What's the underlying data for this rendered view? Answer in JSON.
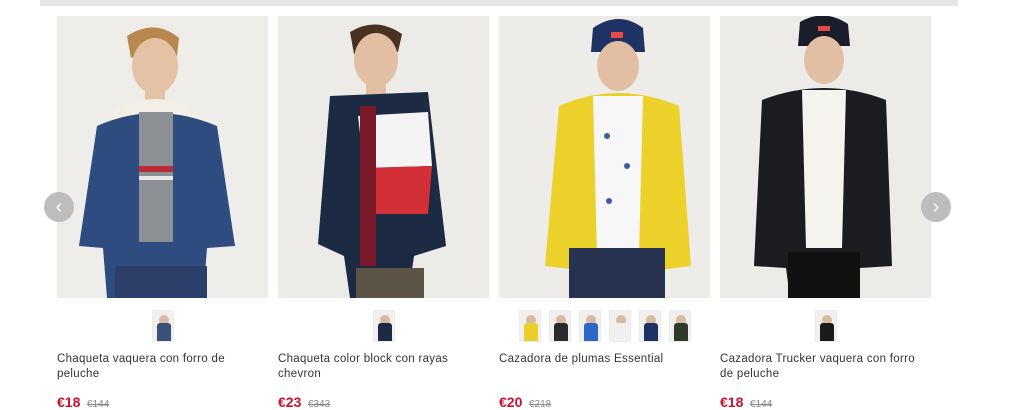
{
  "carousel": {
    "prev_icon": "chevron-left-icon",
    "next_icon": "chevron-right-icon",
    "products": [
      {
        "title": "Chaqueta vaquera con forro de peluche",
        "price": "€18",
        "old_price": "€144",
        "swatch_colors": [
          "#3a4f7a"
        ]
      },
      {
        "title": "Chaqueta color block con rayas chevron",
        "price": "€23",
        "old_price": "€343",
        "swatch_colors": [
          "#1d2a44"
        ]
      },
      {
        "title": "Cazadora de plumas Essential",
        "price": "€20",
        "old_price": "€218",
        "swatch_colors": [
          "#e9cf2a",
          "#2a2a2a",
          "#2a67c9",
          "#f0f0f0",
          "#1e3264",
          "#2e3a2a"
        ]
      },
      {
        "title": "Cazadora Trucker vaquera con forro de peluche",
        "price": "€18",
        "old_price": "€144",
        "swatch_colors": [
          "#1a1a1a"
        ]
      }
    ]
  }
}
